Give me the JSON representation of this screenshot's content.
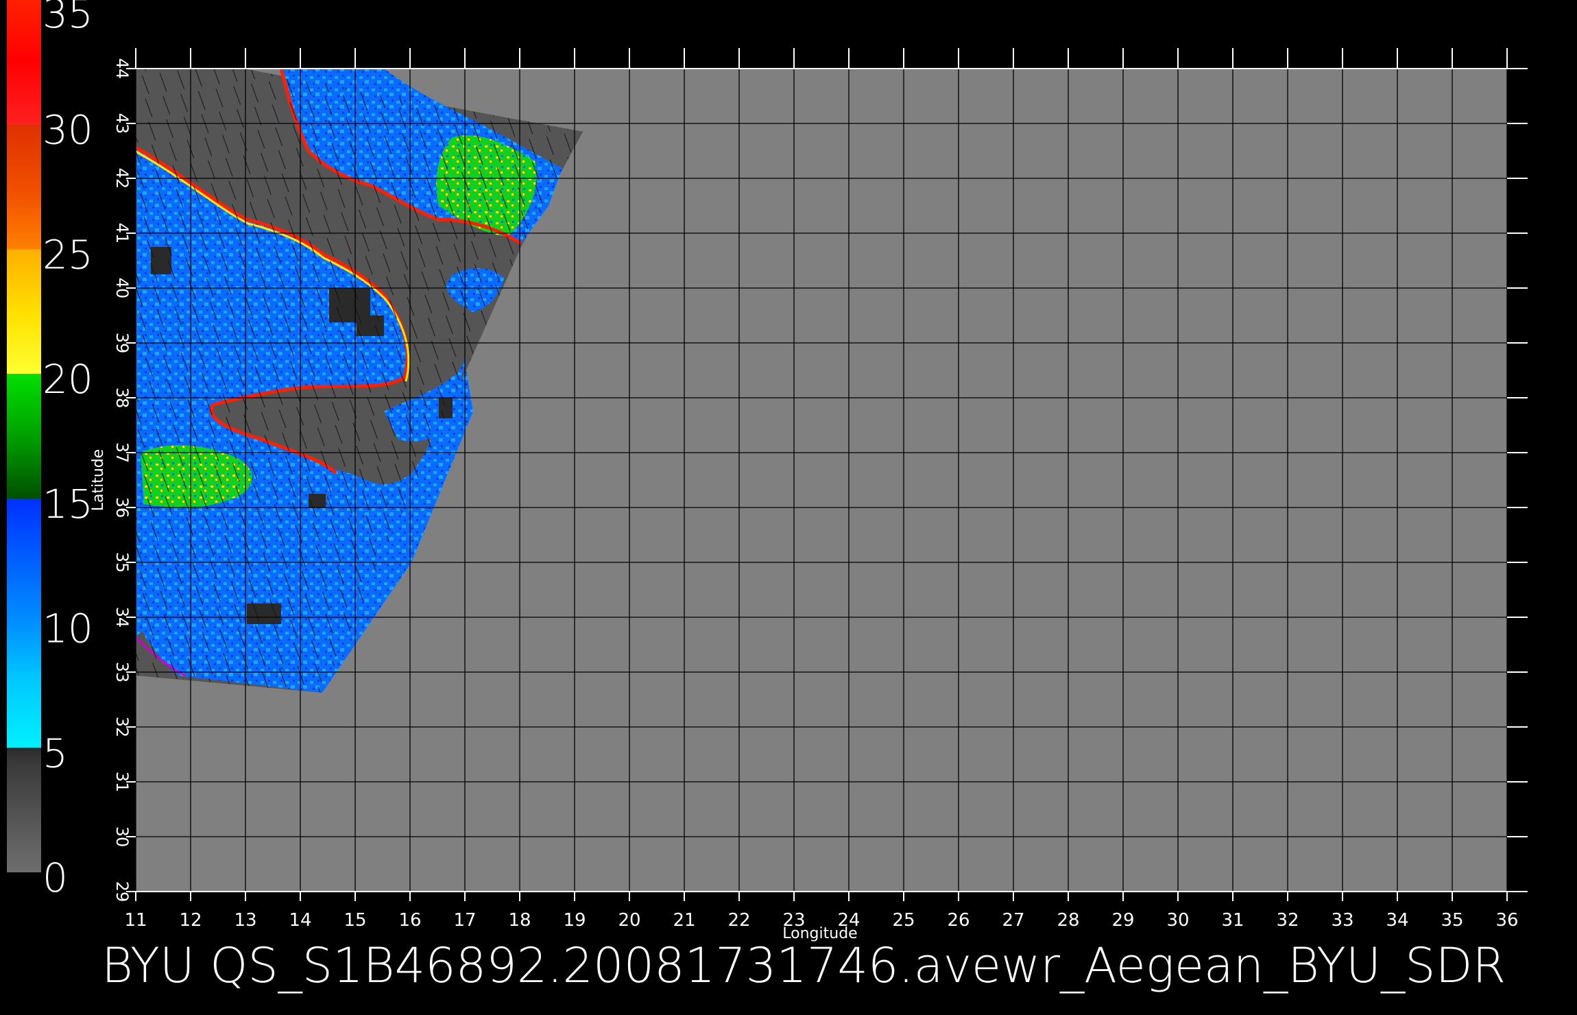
{
  "map": {
    "title": "BYU QS_S1B46892.20081731746.avewr_Aegean_BYU_SDR",
    "xlabel": "Longitude",
    "ylabel": "Latitude",
    "lon_range": [
      11,
      36
    ],
    "lat_range": [
      29,
      44
    ],
    "lon_ticks": [
      "11",
      "12",
      "13",
      "14",
      "15",
      "16",
      "17",
      "18",
      "19",
      "20",
      "21",
      "22",
      "23",
      "24",
      "25",
      "26",
      "27",
      "28",
      "29",
      "30",
      "31",
      "32",
      "33",
      "34",
      "35",
      "36"
    ],
    "lat_ticks": [
      "29",
      "30",
      "31",
      "32",
      "33",
      "34",
      "35",
      "36",
      "37",
      "38",
      "39",
      "40",
      "41",
      "42",
      "43",
      "44"
    ],
    "grid": true,
    "background_color": "#808080",
    "land_color": "#555555",
    "no_data_color": "#808080"
  },
  "colorbar": {
    "labels": [
      "0",
      "5",
      "10",
      "15",
      "20",
      "25",
      "30",
      "35"
    ],
    "range": [
      0,
      35
    ],
    "colors": {
      "gray": "#6e6e6e",
      "dark": "#2a2a2a",
      "cyan": "#00f0ff",
      "light_blue": "#00a8ff",
      "blue": "#0030ff",
      "dark_green": "#006600",
      "green": "#00e000",
      "yellow": "#ffff30",
      "orange": "#ffa000",
      "red_orange": "#e04000",
      "red": "#ff1010",
      "brown": "#c07850"
    }
  },
  "swath": {
    "colors": {
      "ocean_blue": "#0a6cff",
      "ocean_cyan": "#1aa7ff",
      "deep_blue": "#0039e6",
      "green": "#10d020",
      "yellow": "#ffe800",
      "red": "#ff2000",
      "magenta": "#d000d0",
      "arrow": "#111111"
    }
  }
}
